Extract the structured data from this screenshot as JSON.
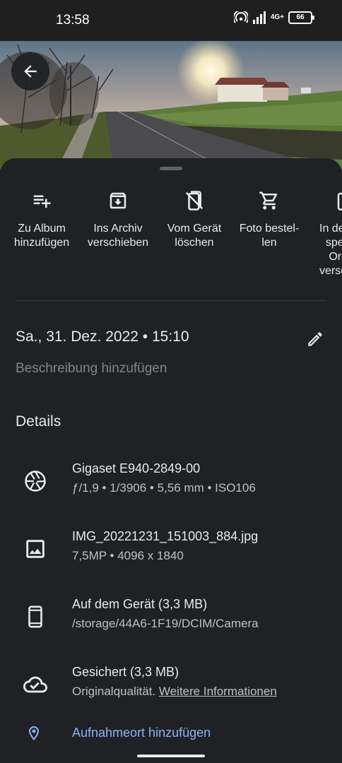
{
  "status_bar": {
    "time": "13:58",
    "network": "4G+",
    "battery": "66"
  },
  "photo": {
    "back_icon": "arrow-back-icon"
  },
  "actions": [
    {
      "label": "Zu Album hinzufügen",
      "icon": "playlist-add-icon"
    },
    {
      "label": "Ins Archiv verschieben",
      "icon": "archive-icon"
    },
    {
      "label": "Vom Gerät löschen",
      "icon": "phone-delete-icon"
    },
    {
      "label": "Foto bestel-len",
      "icon": "cart-icon"
    },
    {
      "label": "In de spe Orc versc",
      "icon": "folder-icon"
    }
  ],
  "date": {
    "text": "Sa., 31. Dez. 2022  •  15:10",
    "edit_icon": "pencil-icon"
  },
  "description_placeholder": "Beschreibung hinzufügen",
  "details": {
    "title": "Details",
    "camera": {
      "model": "Gigaset E940-2849-00",
      "specs": "ƒ/1,9  •  1/3906  •  5,56 mm  •  ISO106"
    },
    "file": {
      "name": "IMG_20221231_151003_884.jpg",
      "info": "7,5MP  •  4096 x 1840"
    },
    "device": {
      "title": "Auf dem Gerät (3,3 MB)",
      "path": "/storage/44A6-1F19/DCIM/Camera"
    },
    "backup": {
      "title": "Gesichert (3,3 MB)",
      "quality": "Originalqualität.",
      "more_link": "Weitere Informationen"
    },
    "location": {
      "label": "Aufnahmeort hinzufügen"
    }
  }
}
